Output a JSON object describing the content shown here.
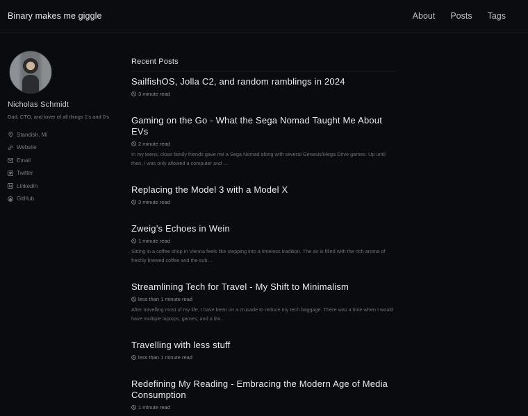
{
  "header": {
    "site_title": "Binary makes me giggle",
    "nav": [
      "About",
      "Posts",
      "Tags"
    ]
  },
  "author": {
    "name": "Nicholas Schmidt",
    "bio": "Dad, CTO, and lover of all things 1's and 0's",
    "links": [
      {
        "label": "Standish, MI",
        "icon": "map-marker-icon"
      },
      {
        "label": "Website",
        "icon": "link-icon"
      },
      {
        "label": "Email",
        "icon": "envelope-icon"
      },
      {
        "label": "Twitter",
        "icon": "twitter-icon"
      },
      {
        "label": "LinkedIn",
        "icon": "linkedin-icon"
      },
      {
        "label": "GitHub",
        "icon": "github-icon"
      }
    ]
  },
  "main": {
    "section_title": "Recent Posts",
    "posts": [
      {
        "title": "SailfishOS, Jolla C2, and random ramblings in 2024",
        "read_time": "3 minute read",
        "excerpt": ""
      },
      {
        "title": "Gaming on the Go - What the Sega Nomad Taught Me About EVs",
        "read_time": "2 minute read",
        "excerpt": "In my teens, close family friends gave me a Sega Nomad along with several Genesis/Mega Drive games. Up until then, I was only allowed a computer and …"
      },
      {
        "title": "Replacing the Model 3 with a Model X",
        "read_time": "3 minute read",
        "excerpt": ""
      },
      {
        "title": "Zweig’s Echoes in Wein",
        "read_time": "1 minute read",
        "excerpt": "Sitting in a coffee shop in Vienna feels like stepping into a timeless tradition. The air is filled with the rich aroma of freshly brewed coffee and the sub…"
      },
      {
        "title": "Streamlining Tech for Travel - My Shift to Minimalism",
        "read_time": "less than 1 minute read",
        "excerpt": "After travelling most of my life, I have been on a crusade to reduce my tech baggage. There was a time when I would have multiple laptops, games, and a lita…"
      },
      {
        "title": "Travelling with less stuff",
        "read_time": "less than 1 minute read",
        "excerpt": ""
      },
      {
        "title": "Redefining My Reading - Embracing the Modern Age of Media Consumption",
        "read_time": "1 minute read",
        "excerpt": ""
      }
    ]
  }
}
